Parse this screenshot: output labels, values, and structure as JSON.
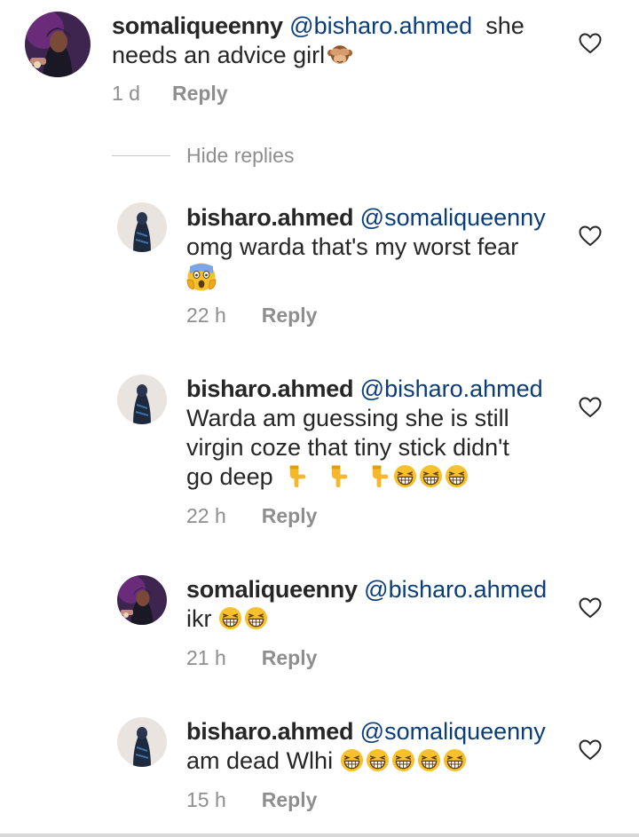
{
  "comments": [
    {
      "username": "somaliqueenny",
      "mention": "@bisharo.ahmed",
      "body_line1": "she",
      "body_line2": "needs an advice girl",
      "emoji": "see-no-evil-monkey",
      "time": "1 d",
      "reply_label": "Reply"
    },
    {
      "username": "bisharo.ahmed",
      "mention": "@somaliqueenny",
      "body_line1": "omg warda that's my worst fear",
      "emoji": "face-screaming-in-fear",
      "time": "22 h",
      "reply_label": "Reply"
    },
    {
      "username": "bisharo.ahmed",
      "mention": "@bisharo.ahmed",
      "body_line1": "Warda am guessing she is still",
      "body_line2": "virgin coze that tiny stick didn't",
      "body_line3": "go deep",
      "emojis": [
        "backhand-index-down",
        "backhand-index-down",
        "backhand-index-down",
        "grinning-squinting-face",
        "grinning-squinting-face",
        "grinning-squinting-face"
      ],
      "time": "22 h",
      "reply_label": "Reply"
    },
    {
      "username": "somaliqueenny",
      "mention": "@bisharo.ahmed",
      "body_line1": "ikr",
      "emojis": [
        "grinning-squinting-face",
        "grinning-squinting-face"
      ],
      "time": "21 h",
      "reply_label": "Reply"
    },
    {
      "username": "bisharo.ahmed",
      "mention": "@somaliqueenny",
      "body_line1": "am dead Wlhi",
      "emojis": [
        "grinning-squinting-face",
        "grinning-squinting-face",
        "grinning-squinting-face",
        "grinning-squinting-face",
        "grinning-squinting-face"
      ],
      "time": "15 h",
      "reply_label": "Reply"
    }
  ],
  "hide_replies_label": "Hide replies",
  "colors": {
    "text": "#262626",
    "mention": "#0a3d7a",
    "meta": "#8e8e8e",
    "emoji_yellow": "#f7c02d"
  },
  "icons": {
    "like": "heart-outline-icon"
  }
}
